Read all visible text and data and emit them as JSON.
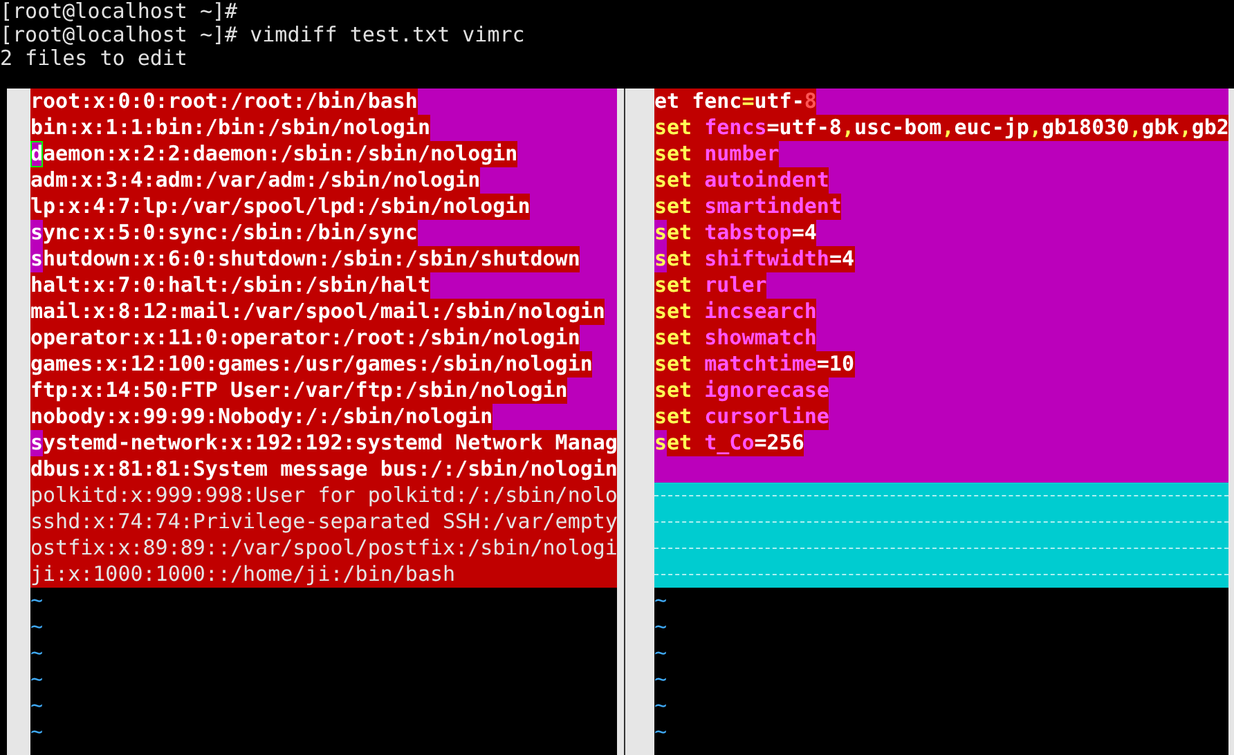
{
  "terminal": {
    "lines": [
      "[root@localhost ~]#",
      "[root@localhost ~]# vimdiff test.txt vimrc",
      "2 files to edit"
    ]
  },
  "diff": {
    "rows": [
      {
        "left": {
          "kind": "change",
          "segments": [
            {
              "text": "root:x:0:0:root:/root:/bin/bash",
              "changed": true
            }
          ]
        },
        "right": {
          "kind": "change",
          "segments": [
            {
              "changed": true,
              "tokens": [
                {
                  "text": "et fenc",
                  "kind": "value"
                },
                {
                  "text": "=",
                  "kind": "keyword"
                },
                {
                  "text": "utf-",
                  "kind": "value"
                },
                {
                  "text": "8",
                  "kind": "error"
                }
              ]
            }
          ]
        }
      },
      {
        "left": {
          "kind": "change",
          "segments": [
            {
              "text": "bin:x:1:1:bin:/bin:/sbin/nologin",
              "changed": true
            }
          ]
        },
        "right": {
          "kind": "change",
          "segments": [
            {
              "changed": true,
              "tokens": [
                {
                  "text": "set",
                  "kind": "keyword"
                },
                {
                  "text": " fencs",
                  "kind": "option"
                },
                {
                  "text": "=utf-8",
                  "kind": "value"
                },
                {
                  "text": ",",
                  "kind": "keyword"
                },
                {
                  "text": "usc-bom",
                  "kind": "value"
                },
                {
                  "text": ",",
                  "kind": "keyword"
                },
                {
                  "text": "euc-jp",
                  "kind": "value"
                },
                {
                  "text": ",",
                  "kind": "keyword"
                },
                {
                  "text": "gb18030",
                  "kind": "value"
                },
                {
                  "text": ",",
                  "kind": "keyword"
                },
                {
                  "text": "gbk",
                  "kind": "value"
                },
                {
                  "text": ",",
                  "kind": "keyword"
                },
                {
                  "text": "gb2",
                  "kind": "value"
                }
              ]
            }
          ]
        }
      },
      {
        "left": {
          "kind": "change",
          "segments": [
            {
              "text": "d",
              "changed": false,
              "cursor": true
            },
            {
              "text": "aemon:x:2:2:daemon:/sbin:/sbin/nologin",
              "changed": true
            }
          ]
        },
        "right": {
          "kind": "change",
          "segments": [
            {
              "changed": true,
              "tokens": [
                {
                  "text": "set",
                  "kind": "keyword"
                },
                {
                  "text": " number",
                  "kind": "option"
                }
              ]
            }
          ]
        }
      },
      {
        "left": {
          "kind": "change",
          "segments": [
            {
              "text": "adm:x:3:4:adm:/var/adm:/sbin/nologin",
              "changed": true
            }
          ]
        },
        "right": {
          "kind": "change",
          "segments": [
            {
              "changed": true,
              "tokens": [
                {
                  "text": "set",
                  "kind": "keyword"
                },
                {
                  "text": " autoindent",
                  "kind": "option"
                }
              ]
            }
          ]
        }
      },
      {
        "left": {
          "kind": "change",
          "segments": [
            {
              "text": "lp:x:4:7:lp:/var/spool/lpd:/sbin/nologin",
              "changed": true
            }
          ]
        },
        "right": {
          "kind": "change",
          "segments": [
            {
              "changed": true,
              "tokens": [
                {
                  "text": "set",
                  "kind": "keyword"
                },
                {
                  "text": " smartindent",
                  "kind": "option"
                }
              ]
            }
          ]
        }
      },
      {
        "left": {
          "kind": "change",
          "segments": [
            {
              "text": "s",
              "changed": false
            },
            {
              "text": "ync:x:5:0:sync:/sbin:/bin/sync",
              "changed": true
            }
          ]
        },
        "right": {
          "kind": "change",
          "segments": [
            {
              "changed": false,
              "tokens": [
                {
                  "text": "s",
                  "kind": "keyword"
                }
              ]
            },
            {
              "changed": true,
              "tokens": [
                {
                  "text": "et",
                  "kind": "keyword"
                },
                {
                  "text": " tabstop",
                  "kind": "option"
                },
                {
                  "text": "=4",
                  "kind": "value"
                }
              ]
            }
          ]
        }
      },
      {
        "left": {
          "kind": "change",
          "segments": [
            {
              "text": "s",
              "changed": false
            },
            {
              "text": "hutdown:x:6:0:shutdown:/sbin:/sbin/shutdown",
              "changed": true
            }
          ]
        },
        "right": {
          "kind": "change",
          "segments": [
            {
              "changed": false,
              "tokens": [
                {
                  "text": "s",
                  "kind": "keyword"
                }
              ]
            },
            {
              "changed": true,
              "tokens": [
                {
                  "text": "et",
                  "kind": "keyword"
                },
                {
                  "text": " shiftwidth",
                  "kind": "option"
                },
                {
                  "text": "=4",
                  "kind": "value"
                }
              ]
            }
          ]
        }
      },
      {
        "left": {
          "kind": "change",
          "segments": [
            {
              "text": "halt:x:7:0:halt:/sbin:/sbin/halt",
              "changed": true
            }
          ]
        },
        "right": {
          "kind": "change",
          "segments": [
            {
              "changed": true,
              "tokens": [
                {
                  "text": "set",
                  "kind": "keyword"
                },
                {
                  "text": " ruler",
                  "kind": "option"
                }
              ]
            }
          ]
        }
      },
      {
        "left": {
          "kind": "change",
          "segments": [
            {
              "text": "mail:x:8:12:mail:/var/spool/mail:/sbin/nologin",
              "changed": true
            }
          ]
        },
        "right": {
          "kind": "change",
          "segments": [
            {
              "changed": true,
              "tokens": [
                {
                  "text": "set",
                  "kind": "keyword"
                },
                {
                  "text": " incsearch",
                  "kind": "option"
                }
              ]
            }
          ]
        }
      },
      {
        "left": {
          "kind": "change",
          "segments": [
            {
              "text": "operator:x:11:0:operator:/root:/sbin/nologin",
              "changed": true
            }
          ]
        },
        "right": {
          "kind": "change",
          "segments": [
            {
              "changed": true,
              "tokens": [
                {
                  "text": "set",
                  "kind": "keyword"
                },
                {
                  "text": " showmatch",
                  "kind": "option"
                }
              ]
            }
          ]
        }
      },
      {
        "left": {
          "kind": "change",
          "segments": [
            {
              "text": "games:x:12:100:games:/usr/games:/sbin/nologin",
              "changed": true
            }
          ]
        },
        "right": {
          "kind": "change",
          "segments": [
            {
              "changed": true,
              "tokens": [
                {
                  "text": "set",
                  "kind": "keyword"
                },
                {
                  "text": " matchtime",
                  "kind": "option"
                },
                {
                  "text": "=10",
                  "kind": "value"
                }
              ]
            }
          ]
        }
      },
      {
        "left": {
          "kind": "change",
          "segments": [
            {
              "text": "ftp:x:14:50:FTP User:/var/ftp:/sbin/nologin",
              "changed": true
            }
          ]
        },
        "right": {
          "kind": "change",
          "segments": [
            {
              "changed": true,
              "tokens": [
                {
                  "text": "set",
                  "kind": "keyword"
                },
                {
                  "text": " ignorecase",
                  "kind": "option"
                }
              ]
            }
          ]
        }
      },
      {
        "left": {
          "kind": "change",
          "segments": [
            {
              "text": "nobody:x:99:99:Nobody:/:/sbin/nologin",
              "changed": true
            }
          ]
        },
        "right": {
          "kind": "change",
          "segments": [
            {
              "changed": true,
              "tokens": [
                {
                  "text": "set",
                  "kind": "keyword"
                },
                {
                  "text": " cursorline",
                  "kind": "option"
                }
              ]
            }
          ]
        }
      },
      {
        "left": {
          "kind": "change",
          "segments": [
            {
              "text": "s",
              "changed": false
            },
            {
              "text": "ystemd-network:x:192:192:systemd Network Manag",
              "changed": true
            }
          ]
        },
        "right": {
          "kind": "change",
          "segments": [
            {
              "changed": false,
              "tokens": [
                {
                  "text": "s",
                  "kind": "keyword"
                }
              ]
            },
            {
              "changed": true,
              "tokens": [
                {
                  "text": "et",
                  "kind": "keyword"
                },
                {
                  "text": " t_Co",
                  "kind": "option"
                },
                {
                  "text": "=256",
                  "kind": "value"
                }
              ]
            }
          ]
        }
      },
      {
        "left": {
          "kind": "change",
          "segments": [
            {
              "text": "dbus:x:81:81:System message bus:/:/sbin/nologin",
              "changed": true
            }
          ]
        },
        "right": {
          "kind": "change"
        }
      },
      {
        "left": {
          "kind": "added",
          "text": "polkitd:x:999:998:User for polkitd:/:/sbin/nolo"
        },
        "right": {
          "kind": "filler"
        }
      },
      {
        "left": {
          "kind": "added",
          "text": "sshd:x:74:74:Privilege-separated SSH:/var/empty"
        },
        "right": {
          "kind": "filler"
        }
      },
      {
        "left": {
          "kind": "added",
          "text": "ostfix:x:89:89::/var/spool/postfix:/sbin/nologi"
        },
        "right": {
          "kind": "filler"
        }
      },
      {
        "left": {
          "kind": "added",
          "text": "ji:x:1000:1000::/home/ji:/bin/bash"
        },
        "right": {
          "kind": "filler"
        }
      },
      {
        "left": {
          "kind": "end",
          "text": "~"
        },
        "right": {
          "kind": "end",
          "text": "~"
        }
      },
      {
        "left": {
          "kind": "end",
          "text": "~"
        },
        "right": {
          "kind": "end",
          "text": "~"
        }
      },
      {
        "left": {
          "kind": "end",
          "text": "~"
        },
        "right": {
          "kind": "end",
          "text": "~"
        }
      },
      {
        "left": {
          "kind": "end",
          "text": "~"
        },
        "right": {
          "kind": "end",
          "text": "~"
        }
      },
      {
        "left": {
          "kind": "end",
          "text": "~"
        },
        "right": {
          "kind": "end",
          "text": "~"
        }
      },
      {
        "left": {
          "kind": "end",
          "text": "~"
        },
        "right": {
          "kind": "end",
          "text": "~"
        }
      }
    ]
  }
}
